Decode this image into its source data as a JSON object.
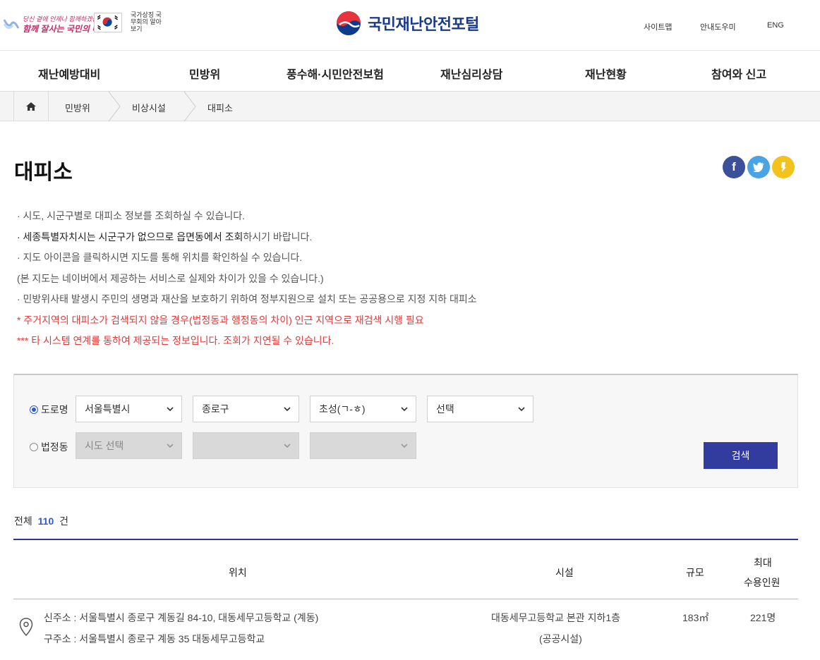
{
  "header": {
    "slogan_line1": "당신 곁에 언제나 함께하겠습니다",
    "slogan_line2": "함께 잘사는 국민의 나라",
    "gov_link": "국가상징 국무회의 알아보기",
    "brand_name": "국민재난안전포털",
    "util": [
      "사이트맵",
      "안내도우미",
      "ENG"
    ]
  },
  "gnb": [
    "재난예방대비",
    "민방위",
    "풍수해·시민안전보험",
    "재난심리상담",
    "재난현황",
    "참여와 신고"
  ],
  "breadcrumb": [
    "민방위",
    "비상시설",
    "대피소"
  ],
  "page": {
    "title": "대피소",
    "sns": [
      "facebook-icon",
      "twitter-icon",
      "kakaostory-icon"
    ]
  },
  "notes": {
    "n1": "· 시도, 시군구별로 대피소 정보를 조회하실 수 있습니다.",
    "n2_a": "· 세종특별자치시는 시군구가 없으므로 읍면동에서 조회",
    "n2_b": "하시기 바랍니다.",
    "n3": "· 지도 아이콘을 클릭하시면 지도를 통해 위치를 확인하실 수 있습니다.",
    "n4": "(본 지도는 네이버에서 제공하는 서비스로 실제와 차이가 있을 수 있습니다.)",
    "n5": "· 민방위사태 발생시 주민의 생명과 재산을 보호하기 위하여 정부지원으로 설치 또는 공공용으로 지정 지하 대피소",
    "n6": "* 주거지역의 대피소가 검색되지 않을 경우(법정동과 행정동의 차이) 인근 지역으로 재검색 시행 필요",
    "n7": "*** 타 시스템 연계를 통하여 제공되는 정보입니다. 조회가 지연될 수 있습니다."
  },
  "search": {
    "road_label": "도로명",
    "road_selects": [
      "서울특별시",
      "종로구",
      "초성(ㄱ-ㅎ)",
      "선택"
    ],
    "legal_label": "법정동",
    "legal_selects": [
      "시도 선택",
      "",
      ""
    ],
    "button": "검색"
  },
  "result": {
    "total_prefix": "전체",
    "total_count": "110",
    "total_suffix": "건",
    "headers": {
      "location": "위치",
      "facility": "시설",
      "scale": "규모",
      "capacity_1": "최대",
      "capacity_2": "수용인원"
    },
    "rows": [
      {
        "new_addr": "신주소 : 서울특별시 종로구 계동길 84-10, 대동세무고등학교 (계동)",
        "old_addr": "구주소 : 서울특별시 종로구 계동 35 대동세무고등학교",
        "facility_1": "대동세무고등학교 본관 지하1층",
        "facility_2": "(공공시설)",
        "scale": "183㎡",
        "capacity": "221명"
      }
    ]
  },
  "colors": {
    "brand_blue": "#1a3a8a",
    "nav_button": "#313c9e",
    "warning_red": "#e03a3a",
    "count_blue": "#2a5bd7"
  }
}
